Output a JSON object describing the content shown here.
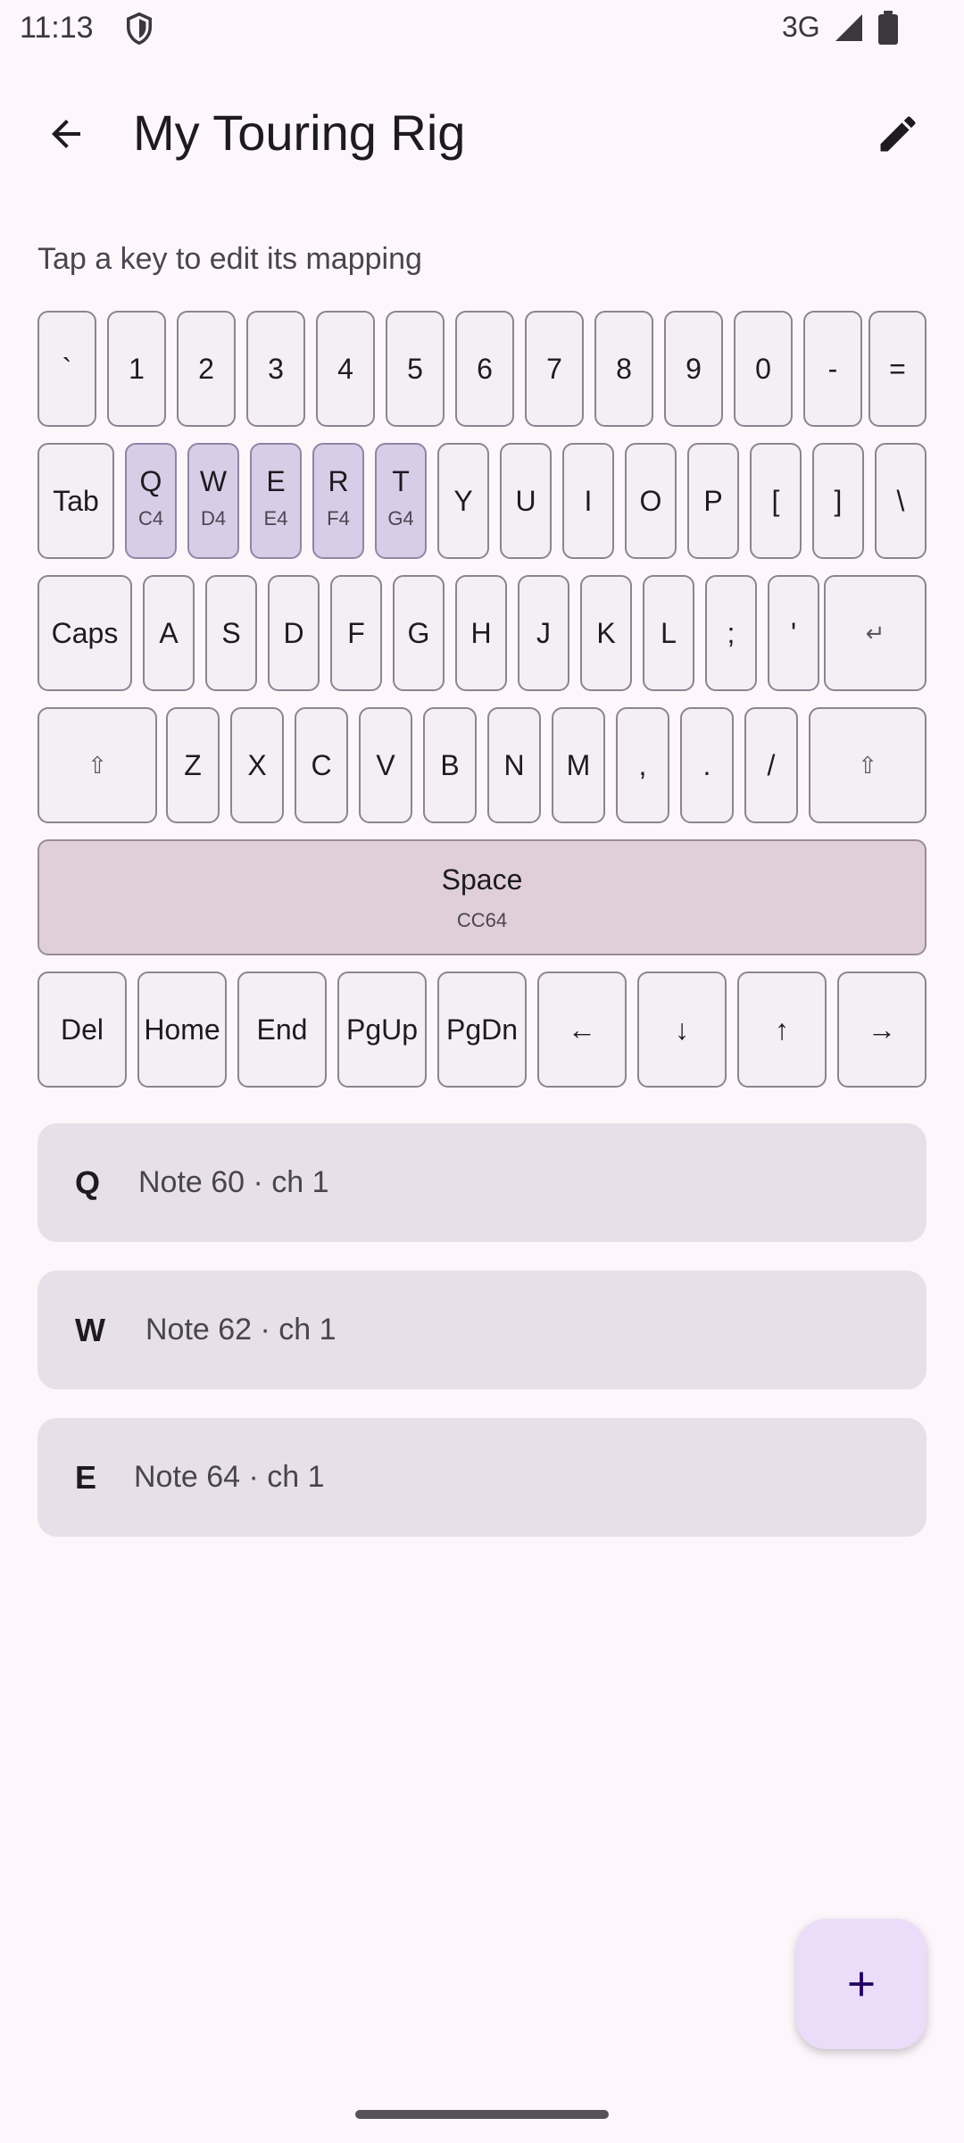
{
  "status": {
    "time": "11:13",
    "network": "3G"
  },
  "header": {
    "title": "My Touring Rig"
  },
  "hint": "Tap a key to edit its mapping",
  "keyboard": {
    "rows": [
      [
        {
          "label": "`"
        },
        {
          "label": "1"
        },
        {
          "label": "2"
        },
        {
          "label": "3"
        },
        {
          "label": "4"
        },
        {
          "label": "5"
        },
        {
          "label": "6"
        },
        {
          "label": "7"
        },
        {
          "label": "8"
        },
        {
          "label": "9"
        },
        {
          "label": "0"
        },
        {
          "label": "-"
        },
        {
          "label": "="
        }
      ],
      [
        {
          "label": "Tab"
        },
        {
          "label": "Q",
          "sub": "C4"
        },
        {
          "label": "W",
          "sub": "D4"
        },
        {
          "label": "E",
          "sub": "E4"
        },
        {
          "label": "R",
          "sub": "F4"
        },
        {
          "label": "T",
          "sub": "G4"
        },
        {
          "label": "Y"
        },
        {
          "label": "U"
        },
        {
          "label": "I"
        },
        {
          "label": "O"
        },
        {
          "label": "P"
        },
        {
          "label": "["
        },
        {
          "label": "]"
        },
        {
          "label": "\\"
        }
      ],
      [
        {
          "label": "Caps"
        },
        {
          "label": "A"
        },
        {
          "label": "S"
        },
        {
          "label": "D"
        },
        {
          "label": "F"
        },
        {
          "label": "G"
        },
        {
          "label": "H"
        },
        {
          "label": "J"
        },
        {
          "label": "K"
        },
        {
          "label": "L"
        },
        {
          "label": ";"
        },
        {
          "label": "'"
        },
        {
          "label": "↵"
        }
      ],
      [
        {
          "label": "⇧"
        },
        {
          "label": "Z"
        },
        {
          "label": "X"
        },
        {
          "label": "C"
        },
        {
          "label": "V"
        },
        {
          "label": "B"
        },
        {
          "label": "N"
        },
        {
          "label": "M"
        },
        {
          "label": ","
        },
        {
          "label": "."
        },
        {
          "label": "/"
        },
        {
          "label": "⇧"
        }
      ],
      [
        {
          "label": "Space",
          "sub": "CC64"
        }
      ],
      [
        {
          "label": "Del"
        },
        {
          "label": "Home"
        },
        {
          "label": "End"
        },
        {
          "label": "PgUp"
        },
        {
          "label": "PgDn"
        },
        {
          "label": "←"
        },
        {
          "label": "↓"
        },
        {
          "label": "↑"
        },
        {
          "label": "→"
        }
      ]
    ]
  },
  "mappings": [
    {
      "key": "Q",
      "desc": "Note 60 · ch 1"
    },
    {
      "key": "W",
      "desc": "Note 62 · ch 1"
    },
    {
      "key": "E",
      "desc": "Note 64 · ch 1"
    }
  ],
  "colors": {
    "background": "#fdf7fc",
    "mapped_key": "#d8cde7",
    "space_key": "#e0cfd8",
    "fab": "#ebdcfa"
  },
  "icons": {
    "back": "arrow-back-icon",
    "edit": "pencil-icon",
    "fab": "plus-icon"
  }
}
